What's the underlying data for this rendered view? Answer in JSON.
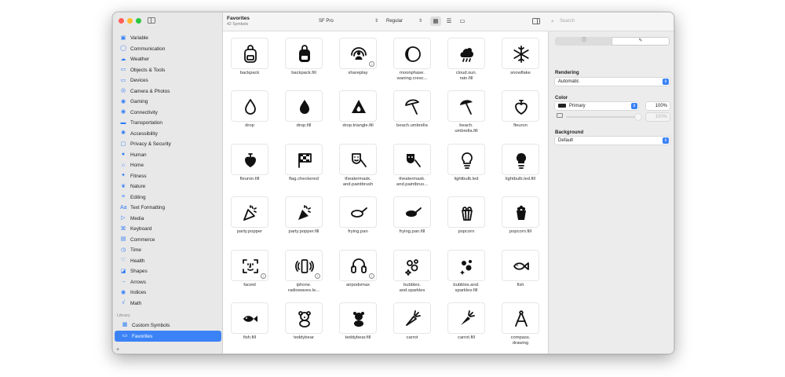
{
  "colors": {
    "accent": "#3b82f6",
    "close": "#ff5f57",
    "minimize": "#febc2e",
    "zoom": "#28c840",
    "primary_swatch": "#222222"
  },
  "sidebar": {
    "categories": [
      {
        "label": "Variable",
        "icon": "variable-icon",
        "glyph": "▣"
      },
      {
        "label": "Communication",
        "icon": "bubble-icon",
        "glyph": "◯"
      },
      {
        "label": "Weather",
        "icon": "cloud-icon",
        "glyph": "☁"
      },
      {
        "label": "Objects & Tools",
        "icon": "folder-icon",
        "glyph": "▭"
      },
      {
        "label": "Devices",
        "icon": "display-icon",
        "glyph": "▭"
      },
      {
        "label": "Camera & Photos",
        "icon": "camera-icon",
        "glyph": "◎"
      },
      {
        "label": "Gaming",
        "icon": "gamecontroller-icon",
        "glyph": "◉"
      },
      {
        "label": "Connectivity",
        "icon": "antenna-icon",
        "glyph": "◉"
      },
      {
        "label": "Transportation",
        "icon": "car-icon",
        "glyph": "▬"
      },
      {
        "label": "Accessibility",
        "icon": "accessibility-icon",
        "glyph": "✺"
      },
      {
        "label": "Privacy & Security",
        "icon": "lock-icon",
        "glyph": "▢"
      },
      {
        "label": "Human",
        "icon": "person-icon",
        "glyph": "●"
      },
      {
        "label": "Home",
        "icon": "house-icon",
        "glyph": "⌂"
      },
      {
        "label": "Fitness",
        "icon": "figure-run-icon",
        "glyph": "✦"
      },
      {
        "label": "Nature",
        "icon": "leaf-icon",
        "glyph": "❦"
      },
      {
        "label": "Editing",
        "icon": "slider-icon",
        "glyph": "≡"
      },
      {
        "label": "Text Formatting",
        "icon": "textformat-icon",
        "glyph": "Aa"
      },
      {
        "label": "Media",
        "icon": "play-pause-icon",
        "glyph": "▷"
      },
      {
        "label": "Keyboard",
        "icon": "command-icon",
        "glyph": "⌘"
      },
      {
        "label": "Commerce",
        "icon": "cart-icon",
        "glyph": "▤"
      },
      {
        "label": "Time",
        "icon": "clock-icon",
        "glyph": "◷"
      },
      {
        "label": "Health",
        "icon": "heart-icon",
        "glyph": "♡"
      },
      {
        "label": "Shapes",
        "icon": "shapes-icon",
        "glyph": "◪"
      },
      {
        "label": "Arrows",
        "icon": "arrow-icon",
        "glyph": "→"
      },
      {
        "label": "Indices",
        "icon": "indices-icon",
        "glyph": "◉"
      },
      {
        "label": "Math",
        "icon": "math-icon",
        "glyph": "√"
      }
    ],
    "library_title": "Library",
    "library": [
      {
        "label": "Custom Symbols",
        "icon": "grid-icon",
        "glyph": "▦",
        "selected": false
      },
      {
        "label": "Favorites",
        "icon": "folder-icon",
        "glyph": "▭",
        "selected": true
      }
    ],
    "add_label": "+"
  },
  "toolbar": {
    "title": "Favorites",
    "subtitle": "42 Symbols",
    "font_value": "SF Pro",
    "weight_value": "Regular",
    "search_placeholder": "Search"
  },
  "symbols": [
    {
      "name": "backpack",
      "icon": "backpack",
      "info": false
    },
    {
      "name": "backpack.fill",
      "icon": "backpack-fill",
      "info": false
    },
    {
      "name": "shareplay",
      "icon": "shareplay",
      "info": true
    },
    {
      "name": "moonphase.\nwaning.cresc...",
      "icon": "moonphase",
      "info": false
    },
    {
      "name": "cloud.sun.\nrain.fill",
      "icon": "cloud-sun-rain",
      "info": false
    },
    {
      "name": "snowflake",
      "icon": "snowflake",
      "info": false
    },
    {
      "name": "drop",
      "icon": "drop",
      "info": false
    },
    {
      "name": "drop.fill",
      "icon": "drop-fill",
      "info": false
    },
    {
      "name": "drop.triangle.fill",
      "icon": "drop-triangle",
      "info": false
    },
    {
      "name": "beach.umbrella",
      "icon": "umbrella",
      "info": false
    },
    {
      "name": "beach.\numbrella.fill",
      "icon": "umbrella-fill",
      "info": false
    },
    {
      "name": "fleuron",
      "icon": "fleuron",
      "info": false
    },
    {
      "name": "fleuron.fill",
      "icon": "fleuron-fill",
      "info": false
    },
    {
      "name": "flag.checkered",
      "icon": "flag-checkered",
      "info": false
    },
    {
      "name": "theatermask.\nand.paintbrush",
      "icon": "theatermask",
      "info": false
    },
    {
      "name": "theatermask.\nand.paintbrus...",
      "icon": "theatermask-fill",
      "info": false
    },
    {
      "name": "lightbulb.led",
      "icon": "lightbulb",
      "info": false
    },
    {
      "name": "lightbulb.led.fill",
      "icon": "lightbulb-fill",
      "info": false
    },
    {
      "name": "party.popper",
      "icon": "party-popper",
      "info": false
    },
    {
      "name": "party.popper.fill",
      "icon": "party-popper-fill",
      "info": false
    },
    {
      "name": "frying.pan",
      "icon": "frying-pan",
      "info": false
    },
    {
      "name": "frying.pan.fill",
      "icon": "frying-pan-fill",
      "info": false
    },
    {
      "name": "popcorn",
      "icon": "popcorn",
      "info": false
    },
    {
      "name": "popcorn.fill",
      "icon": "popcorn-fill",
      "info": false
    },
    {
      "name": "faceid",
      "icon": "faceid",
      "info": true
    },
    {
      "name": "iphone.\nradiowaves.le...",
      "icon": "iphone-radiowaves",
      "info": true
    },
    {
      "name": "airpodsmax",
      "icon": "airpodsmax",
      "info": true
    },
    {
      "name": "bubbles.\nand.sparkles",
      "icon": "bubbles",
      "info": false
    },
    {
      "name": "bubbles.and.\nsparkles.fill",
      "icon": "bubbles-fill",
      "info": false
    },
    {
      "name": "fish",
      "icon": "fish",
      "info": false
    },
    {
      "name": "fish.fill",
      "icon": "fish-fill",
      "info": false
    },
    {
      "name": "teddybear",
      "icon": "teddybear",
      "info": false
    },
    {
      "name": "teddybear.fill",
      "icon": "teddybear-fill",
      "info": false
    },
    {
      "name": "carrot",
      "icon": "carrot",
      "info": false
    },
    {
      "name": "carrot.fill",
      "icon": "carrot-fill",
      "info": false
    },
    {
      "name": "compass.\ndrawing",
      "icon": "compass-drawing",
      "info": false
    }
  ],
  "inspector": {
    "tabs": [
      {
        "label": "ⓘ",
        "icon": "info-icon",
        "active": false
      },
      {
        "label": "✎",
        "icon": "paintbrush-icon",
        "active": true
      }
    ],
    "rendering_label": "Rendering",
    "rendering_value": "Automatic",
    "color_label": "Color",
    "primary_color": "Primary",
    "primary_opacity": "100%",
    "secondary_opacity": "100%",
    "background_label": "Background",
    "background_value": "Default"
  }
}
